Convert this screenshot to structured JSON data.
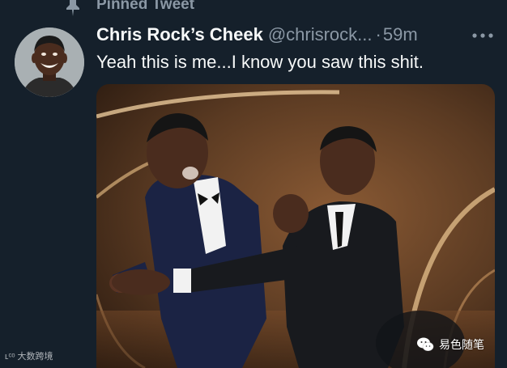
{
  "pinned": {
    "label": "Pinned Tweet",
    "icon": "pin-icon"
  },
  "tweet": {
    "display_name": "Chris Rock’s Cheek",
    "handle": "@chrisrock...",
    "separator": "·",
    "time": "59m",
    "text": "Yeah this is me...I know you saw this shit.",
    "more_icon": "more-icon",
    "avatar": "avatar"
  },
  "watermarks": {
    "left": "大数跨境",
    "right": "易色随笔"
  },
  "colors": {
    "background": "#15202b",
    "primary_text": "#f7f9f9",
    "secondary_text": "#8b98a5"
  }
}
